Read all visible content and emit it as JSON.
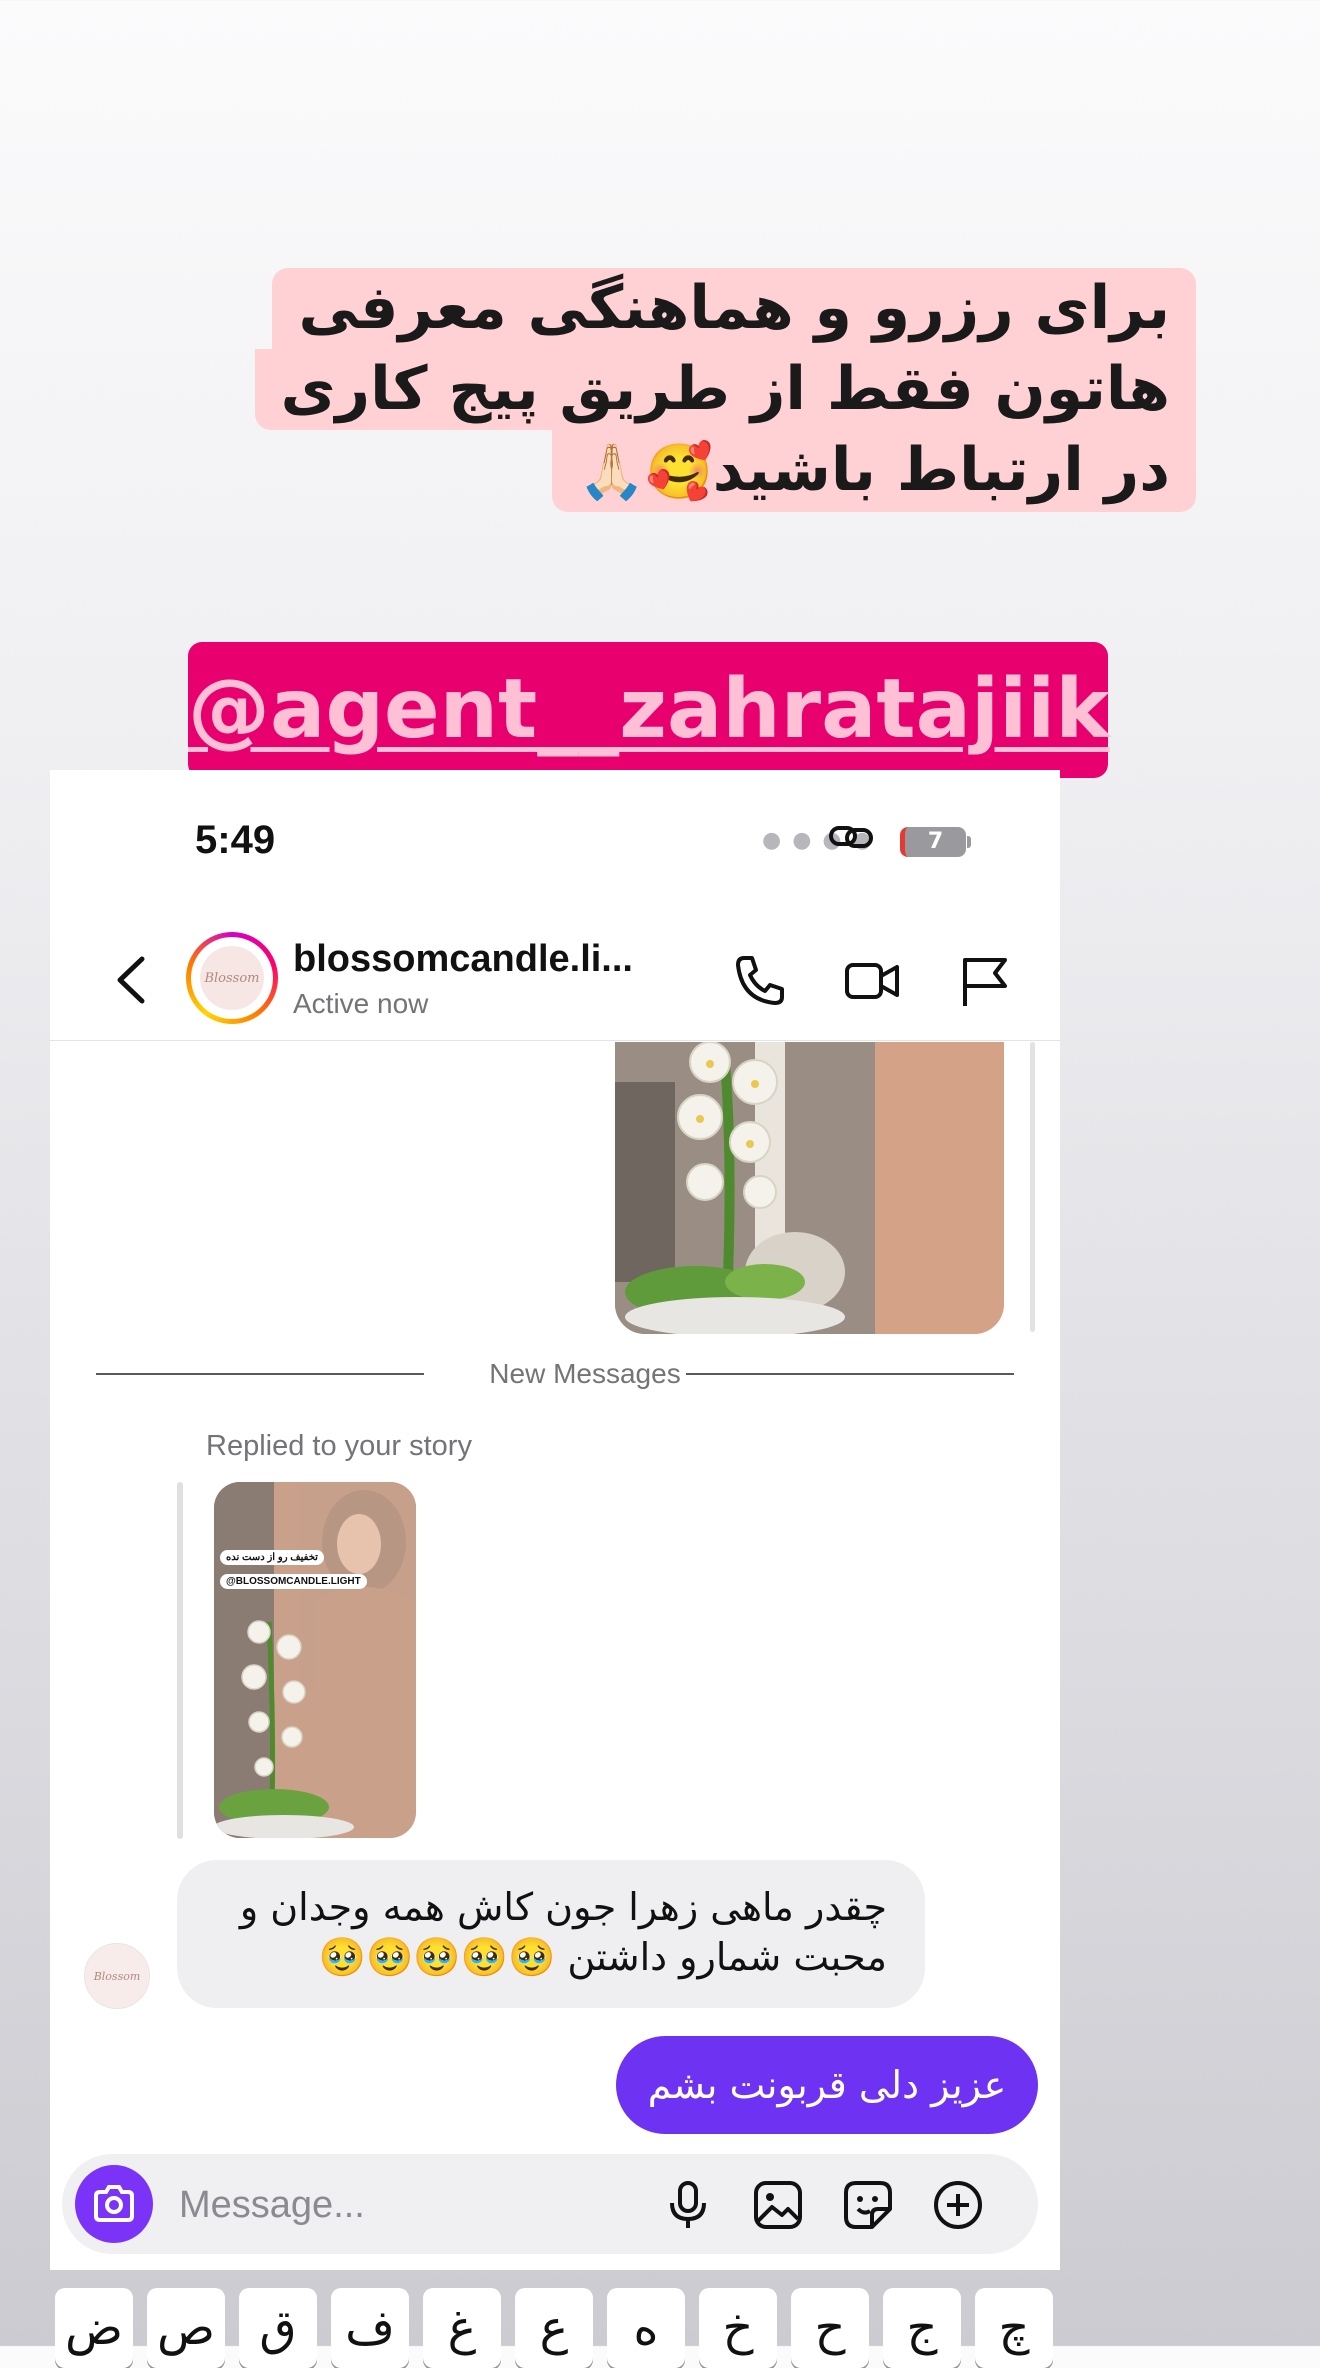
{
  "story": {
    "line1": "برای رزرو و هماهنگی معرفی",
    "line2": "هاتون فقط از طریق پیج کاری",
    "line3": "در ارتباط باشید",
    "line3_emoji": "🥰🙏🏻",
    "mention": "@agent__zahratajiik"
  },
  "status_bar": {
    "time": "5:49",
    "battery": "7",
    "battery_color": "#e53935"
  },
  "header": {
    "name": "blossomcandle.li...",
    "status": "Active now",
    "avatar_text": "Blossom"
  },
  "divider": {
    "label": "New Messages"
  },
  "reply": {
    "label": "Replied to your story",
    "thumb_tag1": "تخفیف رو از دست نده",
    "thumb_tag2": "@BLOSSOMCANDLE.LIGHT"
  },
  "messages": [
    {
      "text": "چقدر ماهی زهرا جون کاش همه وجدان و محبت شمارو داشتن 🥹🥹🥹🥹🥹",
      "from": "them"
    },
    {
      "text": "عزیز دلی قربونت بشم",
      "from": "me"
    }
  ],
  "composer": {
    "placeholder": "Message..."
  },
  "keyboard": {
    "keys": [
      "ض",
      "ص",
      "ق",
      "ف",
      "غ",
      "ع",
      "ه",
      "خ",
      "ح",
      "ج",
      "چ"
    ]
  },
  "colors": {
    "accent": "#6e33f2",
    "mention_bg": "#e8006f",
    "story_bg": "#ffd1d4"
  }
}
